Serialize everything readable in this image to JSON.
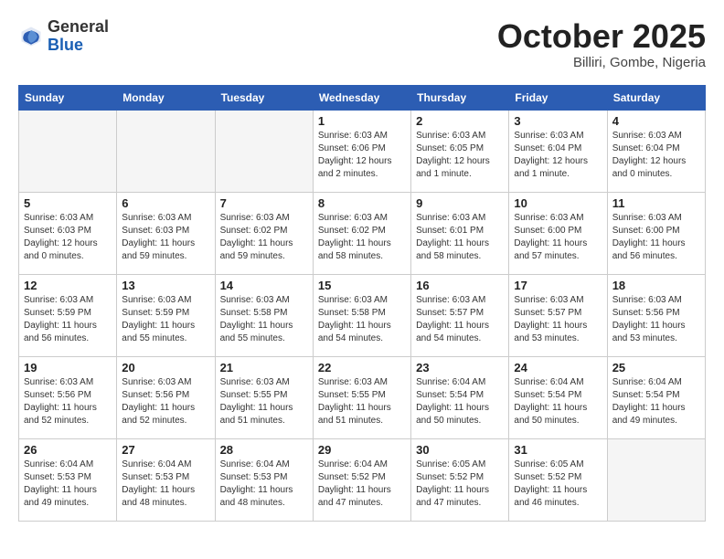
{
  "header": {
    "logo_general": "General",
    "logo_blue": "Blue",
    "month": "October 2025",
    "location": "Billiri, Gombe, Nigeria"
  },
  "days_of_week": [
    "Sunday",
    "Monday",
    "Tuesday",
    "Wednesday",
    "Thursday",
    "Friday",
    "Saturday"
  ],
  "weeks": [
    [
      {
        "day": "",
        "info": ""
      },
      {
        "day": "",
        "info": ""
      },
      {
        "day": "",
        "info": ""
      },
      {
        "day": "1",
        "info": "Sunrise: 6:03 AM\nSunset: 6:06 PM\nDaylight: 12 hours\nand 2 minutes."
      },
      {
        "day": "2",
        "info": "Sunrise: 6:03 AM\nSunset: 6:05 PM\nDaylight: 12 hours\nand 1 minute."
      },
      {
        "day": "3",
        "info": "Sunrise: 6:03 AM\nSunset: 6:04 PM\nDaylight: 12 hours\nand 1 minute."
      },
      {
        "day": "4",
        "info": "Sunrise: 6:03 AM\nSunset: 6:04 PM\nDaylight: 12 hours\nand 0 minutes."
      }
    ],
    [
      {
        "day": "5",
        "info": "Sunrise: 6:03 AM\nSunset: 6:03 PM\nDaylight: 12 hours\nand 0 minutes."
      },
      {
        "day": "6",
        "info": "Sunrise: 6:03 AM\nSunset: 6:03 PM\nDaylight: 11 hours\nand 59 minutes."
      },
      {
        "day": "7",
        "info": "Sunrise: 6:03 AM\nSunset: 6:02 PM\nDaylight: 11 hours\nand 59 minutes."
      },
      {
        "day": "8",
        "info": "Sunrise: 6:03 AM\nSunset: 6:02 PM\nDaylight: 11 hours\nand 58 minutes."
      },
      {
        "day": "9",
        "info": "Sunrise: 6:03 AM\nSunset: 6:01 PM\nDaylight: 11 hours\nand 58 minutes."
      },
      {
        "day": "10",
        "info": "Sunrise: 6:03 AM\nSunset: 6:00 PM\nDaylight: 11 hours\nand 57 minutes."
      },
      {
        "day": "11",
        "info": "Sunrise: 6:03 AM\nSunset: 6:00 PM\nDaylight: 11 hours\nand 56 minutes."
      }
    ],
    [
      {
        "day": "12",
        "info": "Sunrise: 6:03 AM\nSunset: 5:59 PM\nDaylight: 11 hours\nand 56 minutes."
      },
      {
        "day": "13",
        "info": "Sunrise: 6:03 AM\nSunset: 5:59 PM\nDaylight: 11 hours\nand 55 minutes."
      },
      {
        "day": "14",
        "info": "Sunrise: 6:03 AM\nSunset: 5:58 PM\nDaylight: 11 hours\nand 55 minutes."
      },
      {
        "day": "15",
        "info": "Sunrise: 6:03 AM\nSunset: 5:58 PM\nDaylight: 11 hours\nand 54 minutes."
      },
      {
        "day": "16",
        "info": "Sunrise: 6:03 AM\nSunset: 5:57 PM\nDaylight: 11 hours\nand 54 minutes."
      },
      {
        "day": "17",
        "info": "Sunrise: 6:03 AM\nSunset: 5:57 PM\nDaylight: 11 hours\nand 53 minutes."
      },
      {
        "day": "18",
        "info": "Sunrise: 6:03 AM\nSunset: 5:56 PM\nDaylight: 11 hours\nand 53 minutes."
      }
    ],
    [
      {
        "day": "19",
        "info": "Sunrise: 6:03 AM\nSunset: 5:56 PM\nDaylight: 11 hours\nand 52 minutes."
      },
      {
        "day": "20",
        "info": "Sunrise: 6:03 AM\nSunset: 5:56 PM\nDaylight: 11 hours\nand 52 minutes."
      },
      {
        "day": "21",
        "info": "Sunrise: 6:03 AM\nSunset: 5:55 PM\nDaylight: 11 hours\nand 51 minutes."
      },
      {
        "day": "22",
        "info": "Sunrise: 6:03 AM\nSunset: 5:55 PM\nDaylight: 11 hours\nand 51 minutes."
      },
      {
        "day": "23",
        "info": "Sunrise: 6:04 AM\nSunset: 5:54 PM\nDaylight: 11 hours\nand 50 minutes."
      },
      {
        "day": "24",
        "info": "Sunrise: 6:04 AM\nSunset: 5:54 PM\nDaylight: 11 hours\nand 50 minutes."
      },
      {
        "day": "25",
        "info": "Sunrise: 6:04 AM\nSunset: 5:54 PM\nDaylight: 11 hours\nand 49 minutes."
      }
    ],
    [
      {
        "day": "26",
        "info": "Sunrise: 6:04 AM\nSunset: 5:53 PM\nDaylight: 11 hours\nand 49 minutes."
      },
      {
        "day": "27",
        "info": "Sunrise: 6:04 AM\nSunset: 5:53 PM\nDaylight: 11 hours\nand 48 minutes."
      },
      {
        "day": "28",
        "info": "Sunrise: 6:04 AM\nSunset: 5:53 PM\nDaylight: 11 hours\nand 48 minutes."
      },
      {
        "day": "29",
        "info": "Sunrise: 6:04 AM\nSunset: 5:52 PM\nDaylight: 11 hours\nand 47 minutes."
      },
      {
        "day": "30",
        "info": "Sunrise: 6:05 AM\nSunset: 5:52 PM\nDaylight: 11 hours\nand 47 minutes."
      },
      {
        "day": "31",
        "info": "Sunrise: 6:05 AM\nSunset: 5:52 PM\nDaylight: 11 hours\nand 46 minutes."
      },
      {
        "day": "",
        "info": ""
      }
    ]
  ]
}
